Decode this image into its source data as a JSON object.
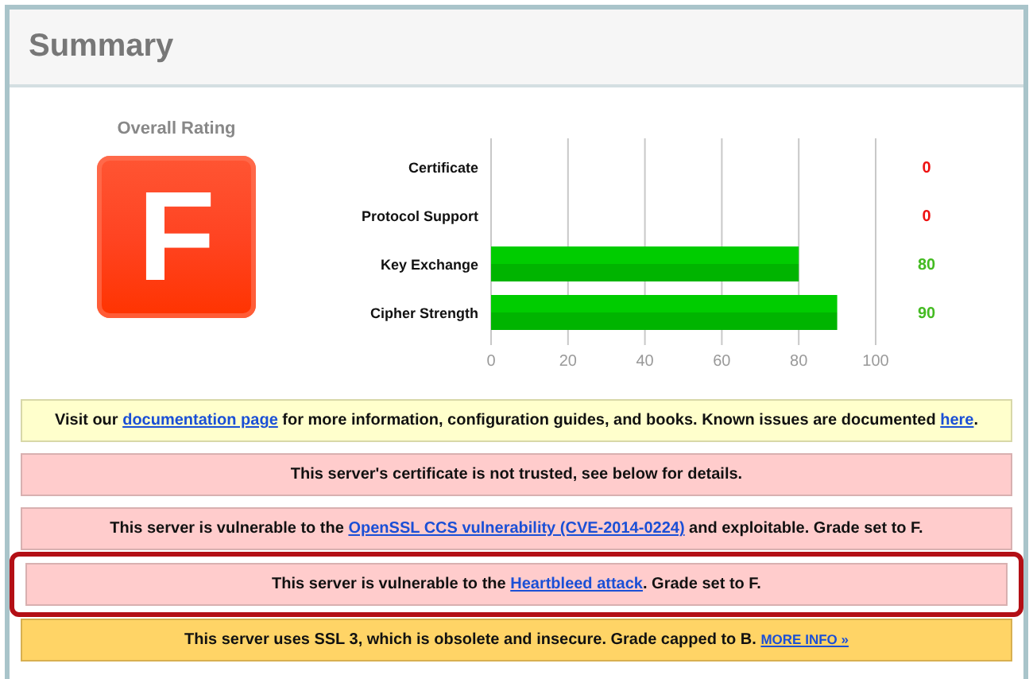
{
  "header": {
    "title": "Summary"
  },
  "rating": {
    "label": "Overall Rating",
    "grade": "F"
  },
  "chart_data": {
    "type": "bar",
    "orientation": "horizontal",
    "categories": [
      "Certificate",
      "Protocol Support",
      "Key Exchange",
      "Cipher Strength"
    ],
    "values": [
      0,
      0,
      80,
      90
    ],
    "grid": true,
    "xlim": [
      0,
      100
    ],
    "xticks": [
      0,
      20,
      40,
      60,
      80,
      100
    ],
    "value_labels": [
      "0",
      "0",
      "80",
      "90"
    ]
  },
  "notices": [
    {
      "kind": "info",
      "highlighted": false,
      "parts": [
        {
          "text": "Visit our "
        },
        {
          "link": "documentation page"
        },
        {
          "text": " for more information, configuration guides, and books. Known issues are documented "
        },
        {
          "link": "here"
        },
        {
          "text": "."
        }
      ]
    },
    {
      "kind": "error",
      "highlighted": false,
      "parts": [
        {
          "text": "This server's certificate is not trusted, see below for details."
        }
      ]
    },
    {
      "kind": "error",
      "highlighted": false,
      "parts": [
        {
          "text": "This server is vulnerable to the "
        },
        {
          "link": "OpenSSL CCS vulnerability (CVE-2014-0224)"
        },
        {
          "text": " and exploitable. Grade set to F."
        }
      ]
    },
    {
      "kind": "error",
      "highlighted": true,
      "parts": [
        {
          "text": "This server is vulnerable to the "
        },
        {
          "link": "Heartbleed attack"
        },
        {
          "text": ". Grade set to F."
        }
      ]
    },
    {
      "kind": "warning",
      "highlighted": false,
      "parts": [
        {
          "text": "This server uses SSL 3, which is obsolete and insecure. Grade capped to B. "
        },
        {
          "more": "MORE INFO »"
        }
      ]
    }
  ]
}
